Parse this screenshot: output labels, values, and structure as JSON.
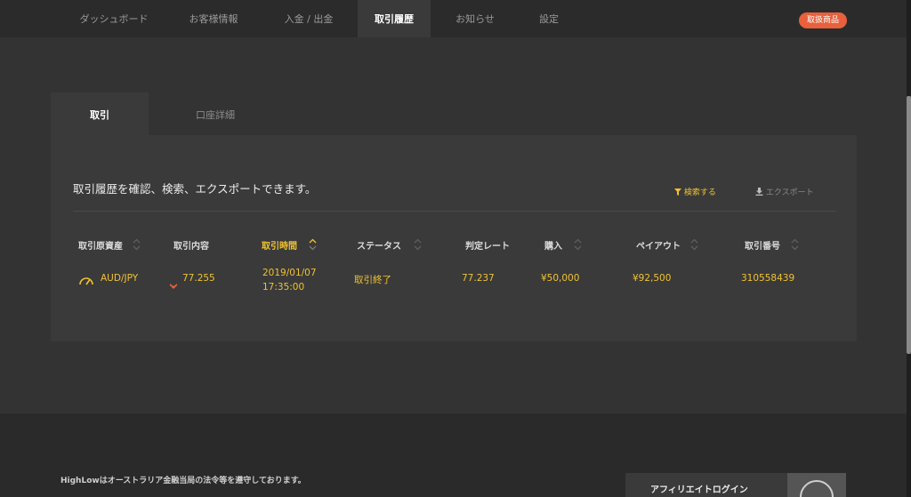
{
  "nav": {
    "items": [
      {
        "label": "ダッシュボード"
      },
      {
        "label": "お客様情報"
      },
      {
        "label": "入金 / 出金"
      },
      {
        "label": "取引履歴"
      },
      {
        "label": "お知らせ"
      },
      {
        "label": "設定"
      }
    ],
    "active_index": 3,
    "badge": "取扱商品"
  },
  "tabs": [
    {
      "label": "取引",
      "active": true
    },
    {
      "label": "口座詳細",
      "active": false
    }
  ],
  "panel": {
    "intro": "取引履歴を確認、検索、エクスポートできます。",
    "search_label": "検索する",
    "export_label": "エクスポート"
  },
  "table": {
    "columns": [
      {
        "label": "取引原資産",
        "sortable": true
      },
      {
        "label": "取引内容",
        "sortable": false
      },
      {
        "label": "取引時間",
        "sortable": true,
        "active": true
      },
      {
        "label": "ステータス",
        "sortable": true
      },
      {
        "label": "判定レート",
        "sortable": false
      },
      {
        "label": "購入",
        "sortable": true
      },
      {
        "label": "ペイアウト",
        "sortable": true
      },
      {
        "label": "取引番号",
        "sortable": true
      }
    ],
    "rows": [
      {
        "asset": "AUD/JPY",
        "direction": "down",
        "content": "77.255",
        "date": "2019/01/07",
        "time": "17:35:00",
        "status": "取引終了",
        "rate": "77.237",
        "purchase": "¥50,000",
        "payout": "¥92,500",
        "trade_no": "310558439"
      }
    ]
  },
  "footer": {
    "legal": "HighLowはオーストラリア金融当局の法令等を遵守しております。",
    "affiliate": "アフィリエイトログイン"
  },
  "colors": {
    "accent": "#f0c330",
    "badge": "#e8603c",
    "down": "#e8603c"
  }
}
